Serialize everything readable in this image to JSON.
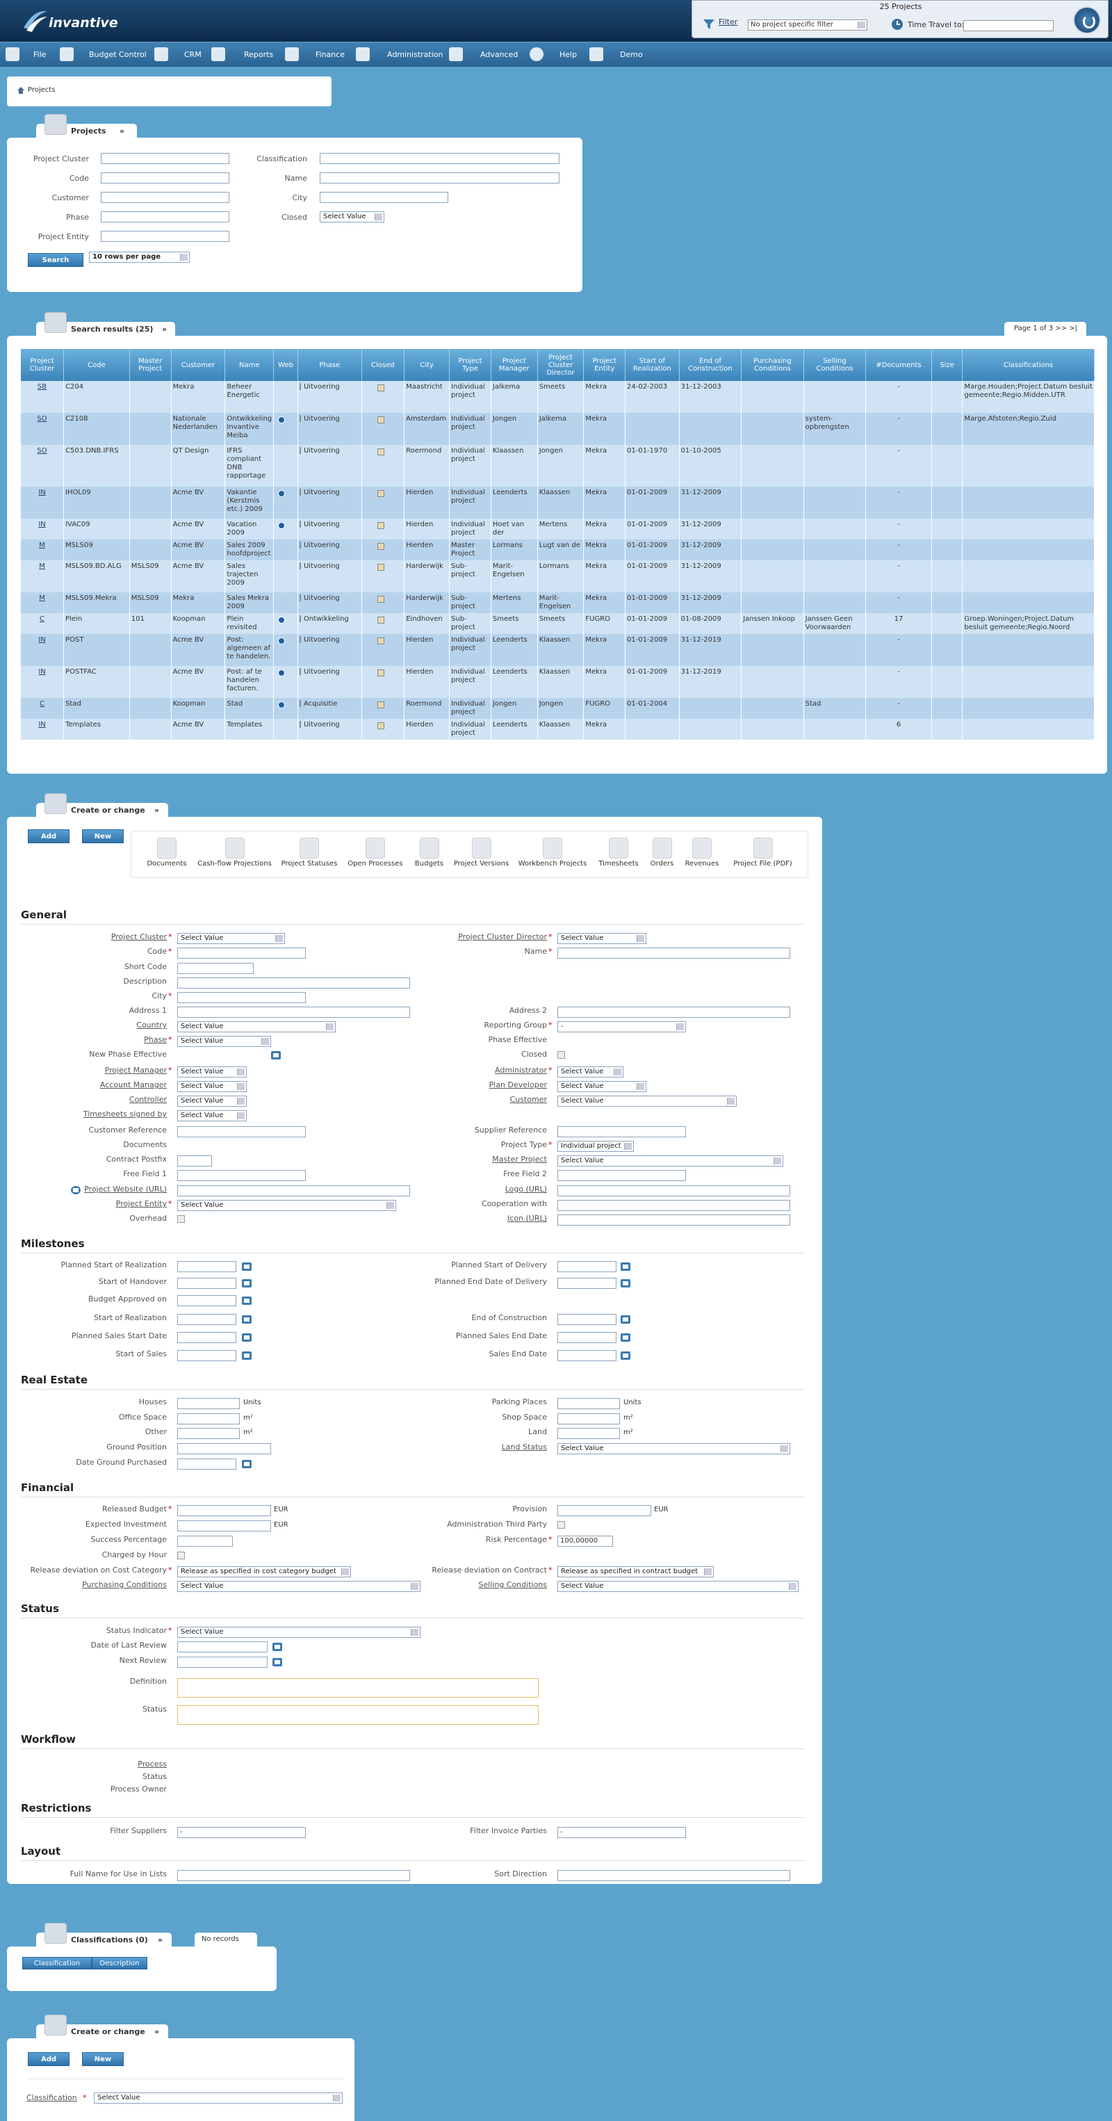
{
  "app": {
    "logo_text": "invantive",
    "project_count": "25 Projects",
    "filter_label": "Filter",
    "filter_value": "No project specific filter",
    "time_travel_label": "Time Travel to:"
  },
  "menu": [
    {
      "label": "File"
    },
    {
      "label": "Budget Control"
    },
    {
      "label": "CRM"
    },
    {
      "label": "Reports"
    },
    {
      "label": "Finance"
    },
    {
      "label": "Administration"
    },
    {
      "label": "Advanced"
    },
    {
      "label": "Help"
    },
    {
      "label": "Demo"
    }
  ],
  "breadcrumb": "Projects",
  "search_panel": {
    "title": "Projects",
    "collapse": "»",
    "labels": {
      "project_cluster": "Project Cluster",
      "code": "Code",
      "customer": "Customer",
      "phase": "Phase",
      "project_entity": "Project Entity",
      "classification": "Classification",
      "name": "Name",
      "city": "City",
      "closed": "Closed"
    },
    "closed_value": "Select Value",
    "search_button": "Search",
    "rows_per_page": "10 rows per page"
  },
  "results": {
    "title": "Search results (25)",
    "collapse": "»",
    "pagination": "Page 1 of 3 >> >|",
    "columns": [
      "Project Cluster",
      "Code",
      "Master Project",
      "Customer",
      "Name",
      "Web",
      "Phase",
      "Closed",
      "City",
      "Project Type",
      "Project Manager",
      "Project Cluster Director",
      "Project Entity",
      "Start of Realization",
      "End of Construction",
      "Purchasing Conditions",
      "Selling Conditions",
      "#Documents",
      "Size",
      "Classifications"
    ],
    "rows": [
      {
        "cluster": "SB",
        "code": "C204",
        "master": "",
        "customer": "Mekra",
        "name": "Beheer Energetic",
        "web": false,
        "phase": "Uitvoering",
        "city": "Maastricht",
        "type": "Individual project",
        "manager": "Jalkema",
        "director": "Smeets",
        "entity": "Mekra",
        "start": "24-02-2003",
        "end": "31-12-2003",
        "purch": "",
        "sell": "",
        "docs": "-",
        "size": "",
        "classif": "Marge.Houden;Project.Datum besluit gemeente;Regio.Midden.UTR"
      },
      {
        "cluster": "SO",
        "code": "C2108",
        "master": "",
        "customer": "Nationale Nederlanden",
        "name": "Ontwikkeling Invantive Meiba",
        "web": true,
        "phase": "Uitvoering",
        "city": "Amsterdam",
        "type": "Individual project",
        "manager": "Jongen",
        "director": "Jalkema",
        "entity": "Mekra",
        "start": "",
        "end": "",
        "purch": "",
        "sell": "system-opbrengsten",
        "docs": "-",
        "size": "",
        "classif": "Marge.Afstoten;Regio.Zuid"
      },
      {
        "cluster": "SO",
        "code": "C503.DNB.IFRS",
        "master": "",
        "customer": "QT Design",
        "name": "IFRS compliant DNB rapportage",
        "web": false,
        "phase": "Uitvoering",
        "city": "Roermond",
        "type": "Individual project",
        "manager": "Klaassen",
        "director": "Jongen",
        "entity": "Mekra",
        "start": "01-01-1970",
        "end": "01-10-2005",
        "purch": "",
        "sell": "",
        "docs": "-",
        "size": "",
        "classif": ""
      },
      {
        "cluster": "IN",
        "code": "IHOL09",
        "master": "",
        "customer": "Acme BV",
        "name": "Vakantie (Kerstmis etc.) 2009",
        "web": true,
        "phase": "Uitvoering",
        "city": "Hierden",
        "type": "Individual project",
        "manager": "Leenderts",
        "director": "Klaassen",
        "entity": "Mekra",
        "start": "01-01-2009",
        "end": "31-12-2009",
        "purch": "",
        "sell": "",
        "docs": "-",
        "size": "",
        "classif": ""
      },
      {
        "cluster": "IN",
        "code": "IVAC09",
        "master": "",
        "customer": "Acme BV",
        "name": "Vacation 2009",
        "web": true,
        "phase": "Uitvoering",
        "city": "Hierden",
        "type": "Individual project",
        "manager": "Hoet van der",
        "director": "Mertens",
        "entity": "Mekra",
        "start": "01-01-2009",
        "end": "31-12-2009",
        "purch": "",
        "sell": "",
        "docs": "-",
        "size": "",
        "classif": ""
      },
      {
        "cluster": "M",
        "code": "MSLS09",
        "master": "",
        "customer": "Acme BV",
        "name": "Sales 2009 hoofdproject",
        "web": false,
        "phase": "Uitvoering",
        "city": "Hierden",
        "type": "Master Project",
        "manager": "Lormans",
        "director": "Lugt van de",
        "entity": "Mekra",
        "start": "01-01-2009",
        "end": "31-12-2009",
        "purch": "",
        "sell": "",
        "docs": "-",
        "size": "",
        "classif": ""
      },
      {
        "cluster": "M",
        "code": "MSLS09.BD.ALG",
        "master": "MSLS09",
        "customer": "Acme BV",
        "name": "Sales trajecten 2009",
        "web": false,
        "phase": "Uitvoering",
        "city": "Harderwijk",
        "type": "Sub-project",
        "manager": "Marit-Engelsen",
        "director": "Lormans",
        "entity": "Mekra",
        "start": "01-01-2009",
        "end": "31-12-2009",
        "purch": "",
        "sell": "",
        "docs": "-",
        "size": "",
        "classif": ""
      },
      {
        "cluster": "M",
        "code": "MSLS09.Mekra",
        "master": "MSLS09",
        "customer": "Mekra",
        "name": "Sales Mekra 2009",
        "web": false,
        "phase": "Uitvoering",
        "city": "Harderwijk",
        "type": "Sub-project",
        "manager": "Mertens",
        "director": "Marit-Engelsen",
        "entity": "Mekra",
        "start": "01-01-2009",
        "end": "31-12-2009",
        "purch": "",
        "sell": "",
        "docs": "-",
        "size": "",
        "classif": ""
      },
      {
        "cluster": "C",
        "code": "Plein",
        "master": "101",
        "customer": "Koopman",
        "name": "Plein revisited",
        "web": true,
        "phase": "Ontwikkeling",
        "city": "Eindhoven",
        "type": "Sub-project",
        "manager": "Smeets",
        "director": "Smeets",
        "entity": "FUGRO",
        "start": "01-01-2009",
        "end": "01-08-2009",
        "purch": "Janssen Inkoop",
        "sell": "Janssen Geen Voorwaarden",
        "docs": "17",
        "size": "",
        "classif": "Groep.Woningen;Project.Datum besluit gemeente;Regio.Noord"
      },
      {
        "cluster": "IN",
        "code": "POST",
        "master": "",
        "customer": "Acme BV",
        "name": "Post: algemeen af te handelen.",
        "web": true,
        "phase": "Uitvoering",
        "city": "Hierden",
        "type": "Individual project",
        "manager": "Leenderts",
        "director": "Klaassen",
        "entity": "Mekra",
        "start": "01-01-2009",
        "end": "31-12-2019",
        "purch": "",
        "sell": "",
        "docs": "-",
        "size": "",
        "classif": ""
      },
      {
        "cluster": "IN",
        "code": "POSTFAC",
        "master": "",
        "customer": "Acme BV",
        "name": "Post: af te handelen facturen.",
        "web": true,
        "phase": "Uitvoering",
        "city": "Hierden",
        "type": "Individual project",
        "manager": "Leenderts",
        "director": "Klaassen",
        "entity": "Mekra",
        "start": "01-01-2009",
        "end": "31-12-2019",
        "purch": "",
        "sell": "",
        "docs": "-",
        "size": "",
        "classif": ""
      },
      {
        "cluster": "C",
        "code": "Stad",
        "master": "",
        "customer": "Koopman",
        "name": "Stad",
        "web": true,
        "phase": "Acquisitie",
        "city": "Roermond",
        "type": "Individual project",
        "manager": "Jongen",
        "director": "Jongen",
        "entity": "FUGRO",
        "start": "01-01-2004",
        "end": "",
        "purch": "",
        "sell": "Stad",
        "docs": "-",
        "size": "",
        "classif": ""
      },
      {
        "cluster": "IN",
        "code": "Templates",
        "master": "",
        "customer": "Acme BV",
        "name": "Templates",
        "web": false,
        "phase": "Uitvoering",
        "city": "Hierden",
        "type": "Individual project",
        "manager": "Leenderts",
        "director": "Klaassen",
        "entity": "Mekra",
        "start": "",
        "end": "",
        "purch": "",
        "sell": "",
        "docs": "6",
        "size": "",
        "classif": ""
      }
    ]
  },
  "create": {
    "title": "Create or change",
    "collapse": "»",
    "add": "Add",
    "new": "New",
    "modules": [
      "Documents",
      "Cash-flow Projections",
      "Project Statuses",
      "Open Processes",
      "Budgets",
      "Project Versions",
      "Workbench Projects",
      "Timesheets",
      "Orders",
      "Revenues",
      "Project File (PDF)"
    ],
    "sections": {
      "general": "General",
      "milestones": "Milestones",
      "real_estate": "Real Estate",
      "financial": "Financial",
      "status": "Status",
      "workflow": "Workflow",
      "restrictions": "Restrictions",
      "layout": "Layout"
    },
    "general": {
      "project_cluster": "Project Cluster",
      "code": "Code",
      "short_code": "Short Code",
      "description": "Description",
      "city": "City",
      "address1": "Address 1",
      "country": "Country",
      "phase": "Phase",
      "new_phase_effective": "New Phase Effective",
      "project_manager": "Project Manager",
      "account_manager": "Account Manager",
      "controller": "Controller",
      "timesheets_signed_by": "Timesheets signed by",
      "customer_reference": "Customer Reference",
      "documents": "Documents",
      "contract_postfix": "Contract Postfix",
      "free_field1": "Free Field 1",
      "project_website": "Project Website (URL)",
      "project_entity": "Project Entity",
      "overhead": "Overhead",
      "project_cluster_director": "Project Cluster Director",
      "name": "Name",
      "address2": "Address 2",
      "reporting_group": "Reporting Group",
      "phase_effective": "Phase Effective",
      "closed": "Closed",
      "administrator": "Administrator",
      "plan_developer": "Plan Developer",
      "customer": "Customer",
      "supplier_reference": "Supplier Reference",
      "project_type": "Project Type",
      "master_project": "Master Project",
      "free_field2": "Free Field 2",
      "logo": "Logo (URL)",
      "cooperation_with": "Cooperation with",
      "icon": "Icon (URL)",
      "select_value": "Select Value",
      "reporting_group_value": "-",
      "project_type_value": "Individual project"
    },
    "milestones": {
      "planned_start_realization": "Planned Start of Realization",
      "start_handover": "Start of Handover",
      "budget_approved": "Budget Approved on",
      "start_realization": "Start of Realization",
      "planned_sales_start": "Planned Sales Start Date",
      "start_sales": "Start of Sales",
      "planned_start_delivery": "Planned Start of Delivery",
      "planned_end_delivery": "Planned End Date of Delivery",
      "end_construction": "End of Construction",
      "planned_sales_end": "Planned Sales End Date",
      "sales_end": "Sales End Date"
    },
    "real_estate": {
      "houses": "Houses",
      "office_space": "Office Space",
      "other": "Other",
      "ground_position": "Ground Position",
      "date_ground": "Date Ground Purchased",
      "parking": "Parking Places",
      "shop_space": "Shop Space",
      "land": "Land",
      "land_status": "Land Status",
      "units": "Units",
      "m2": "m²",
      "select_value": "Select Value"
    },
    "financial": {
      "released_budget": "Released Budget",
      "expected_investment": "Expected Investment",
      "success_pct": "Success Percentage",
      "charged_by_hour": "Charged by Hour",
      "release_dev_cost": "Release deviation on Cost Category",
      "purchasing_conditions": "Purchasing Conditions",
      "provision": "Provision",
      "admin_third": "Administration Third Party",
      "risk_pct": "Risk Percentage",
      "risk_value": "100,00000",
      "release_dev_contract": "Release deviation on Contract",
      "selling_conditions": "Selling Conditions",
      "eur": "EUR",
      "release_cost_value": "Release as specified in cost category budget",
      "release_contract_value": "Release as specified in contract budget",
      "select_value": "Select Value"
    },
    "status": {
      "status_indicator": "Status Indicator",
      "date_last_review": "Date of Last Review",
      "next_review": "Next Review",
      "definition": "Definition",
      "status": "Status",
      "select_value": "Select Value"
    },
    "workflow": {
      "process": "Process",
      "status": "Status",
      "process_owner": "Process Owner"
    },
    "restrictions": {
      "filter_suppliers": "Filter Suppliers",
      "filter_invoice": "Filter Invoice Parties",
      "value": "-"
    },
    "layout": {
      "full_name": "Full Name for Use in Lists",
      "sort_direction": "Sort Direction"
    }
  },
  "classifications": {
    "title": "Classifications (0)",
    "collapse": "»",
    "no_records": "No records",
    "col1": "Classification",
    "col2": "Description"
  },
  "create2": {
    "title": "Create or change",
    "collapse": "»",
    "add": "Add",
    "new": "New",
    "classification": "Classification",
    "select_value": "Select Value"
  }
}
